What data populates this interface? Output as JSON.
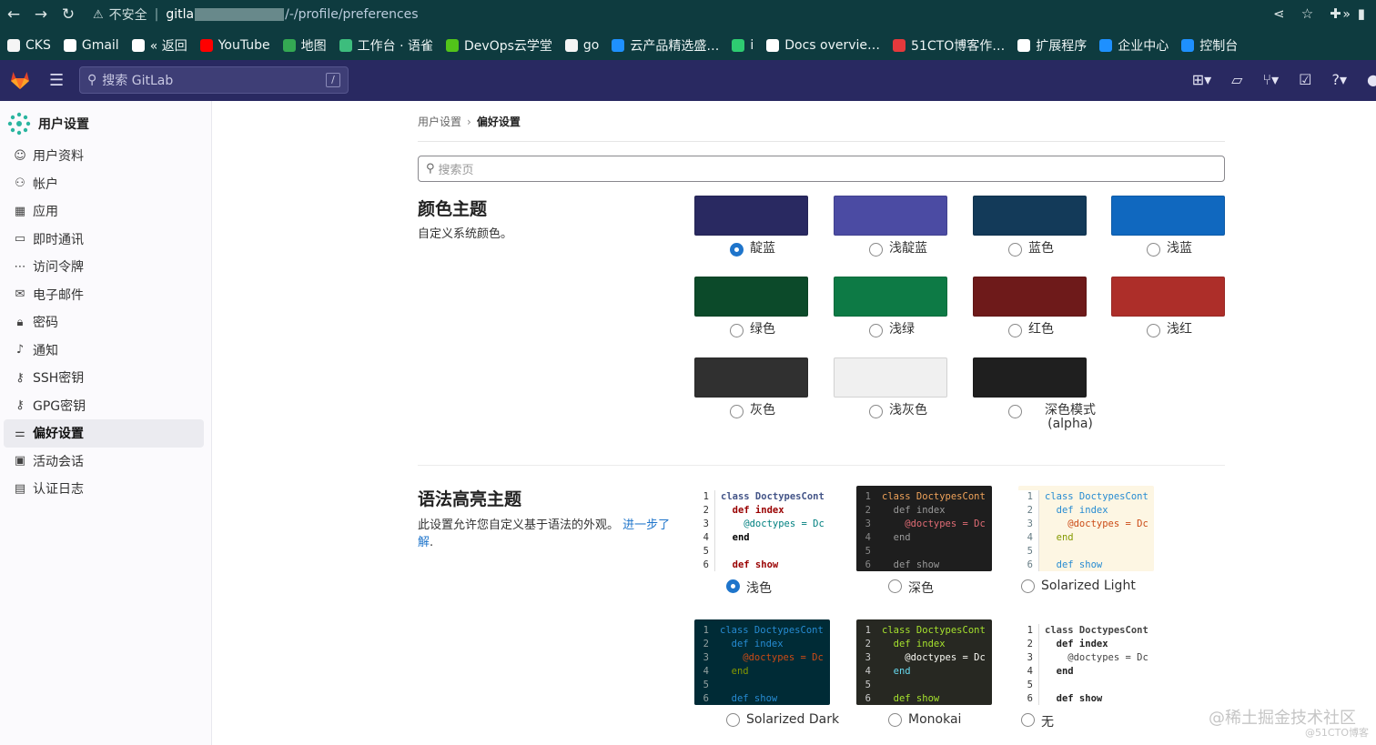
{
  "browser": {
    "security_label": "不安全",
    "host": "gitla",
    "path": "/-/profile/preferences",
    "bookmarks": [
      {
        "label": "CKS",
        "icon": "folder-icon",
        "color": "#f5f5f5"
      },
      {
        "label": "Gmail",
        "icon": "google-icon",
        "color": "#ffffff"
      },
      {
        "label": "« 返回",
        "icon": "globe-icon",
        "color": "#ffffff"
      },
      {
        "label": "YouTube",
        "icon": "youtube-icon",
        "color": "#ff0000"
      },
      {
        "label": "地图",
        "icon": "maps-icon",
        "color": "#34a853"
      },
      {
        "label": "工作台 · 语雀",
        "icon": "yuque-icon",
        "color": "#3dbd7d"
      },
      {
        "label": "DevOps云学堂",
        "icon": "devops-icon",
        "color": "#52c41a"
      },
      {
        "label": "go",
        "icon": "folder-icon",
        "color": "#f5f5f5"
      },
      {
        "label": "云产品精选盛…",
        "icon": "cloud-icon",
        "color": "#1e90ff"
      },
      {
        "label": "i",
        "icon": "green-s-icon",
        "color": "#2ecc71"
      },
      {
        "label": "Docs overvie…",
        "icon": "docs-icon",
        "color": "#ffffff"
      },
      {
        "label": "51CTO博客作…",
        "icon": "51cto-icon",
        "color": "#e4393c"
      },
      {
        "label": "扩展程序",
        "icon": "puzzle-icon",
        "color": "#ffffff"
      },
      {
        "label": "企业中心",
        "icon": "cloud-icon",
        "color": "#1e90ff"
      },
      {
        "label": "控制台",
        "icon": "cloud-icon",
        "color": "#1e90ff"
      }
    ],
    "more": "»"
  },
  "header": {
    "search_placeholder": "搜索 GitLab",
    "search_shortcut": "/"
  },
  "sidebar": {
    "title": "用户设置",
    "items": [
      {
        "label": "用户资料",
        "icon": "profile-icon",
        "glyph": "☺",
        "active": false
      },
      {
        "label": "帐户",
        "icon": "account-icon",
        "glyph": "⚇",
        "active": false
      },
      {
        "label": "应用",
        "icon": "applications-icon",
        "glyph": "▦",
        "active": false
      },
      {
        "label": "即时通讯",
        "icon": "chat-icon",
        "glyph": "▭",
        "active": false
      },
      {
        "label": "访问令牌",
        "icon": "token-icon",
        "glyph": "⋯",
        "active": false
      },
      {
        "label": "电子邮件",
        "icon": "mail-icon",
        "glyph": "✉",
        "active": false
      },
      {
        "label": "密码",
        "icon": "lock-icon",
        "glyph": "🔒︎",
        "active": false
      },
      {
        "label": "通知",
        "icon": "bell-icon",
        "glyph": "♪",
        "active": false
      },
      {
        "label": "SSH密钥",
        "icon": "key-icon",
        "glyph": "⚷",
        "active": false
      },
      {
        "label": "GPG密钥",
        "icon": "key-icon",
        "glyph": "⚷",
        "active": false
      },
      {
        "label": "偏好设置",
        "icon": "preferences-icon",
        "glyph": "⚌",
        "active": true
      },
      {
        "label": "活动会话",
        "icon": "monitor-icon",
        "glyph": "▣",
        "active": false
      },
      {
        "label": "认证日志",
        "icon": "log-icon",
        "glyph": "▤",
        "active": false
      }
    ]
  },
  "breadcrumb": {
    "parent": "用户设置",
    "current": "偏好设置"
  },
  "page_search_placeholder": "搜索页",
  "color_theme": {
    "title": "颜色主题",
    "description": "自定义系统颜色。",
    "options": [
      {
        "label": "靛蓝",
        "color": "#292961",
        "selected": true
      },
      {
        "label": "浅靛蓝",
        "color": "#4b4ba3",
        "selected": false
      },
      {
        "label": "蓝色",
        "color": "#133a59",
        "selected": false
      },
      {
        "label": "浅蓝",
        "color": "#1068bf",
        "selected": false
      },
      {
        "label": "绿色",
        "color": "#0c4a2a",
        "selected": false
      },
      {
        "label": "浅绿",
        "color": "#0d7a45",
        "selected": false
      },
      {
        "label": "红色",
        "color": "#6e1a1a",
        "selected": false
      },
      {
        "label": "浅红",
        "color": "#ad2e29",
        "selected": false
      },
      {
        "label": "灰色",
        "color": "#303030",
        "selected": false
      },
      {
        "label": "浅灰色",
        "color": "#f0f0f0",
        "selected": false
      },
      {
        "label": "深色模式",
        "sublabel": "(alpha)",
        "color": "#1f1f1f",
        "selected": false
      }
    ]
  },
  "syntax_theme": {
    "title": "语法高亮主题",
    "description": "此设置允许您自定义基于语法的外观。",
    "link_text": "进一步了解",
    "link_tail": ".",
    "code_lines": [
      "class DoctypesCont",
      "  def index",
      "    @doctypes = Dc",
      "  end",
      "",
      "  def show"
    ],
    "line_numbers": [
      "1",
      "2",
      "3",
      "4",
      "5",
      "6"
    ],
    "options": [
      {
        "label": "浅色",
        "selected": true,
        "bg": "#ffffff",
        "gutter_bg": "#ffffff",
        "gutter_fg": "#333333",
        "fg": "#333333",
        "kw": "#000000",
        "name": "#445588",
        "var": "#008080",
        "fn": "#990000"
      },
      {
        "label": "深色",
        "selected": false,
        "bg": "#1e1e1e",
        "gutter_bg": "#1e1e1e",
        "gutter_fg": "#888888",
        "fg": "#999999",
        "kw": "#999999",
        "name": "#f0a35a",
        "var": "#e06c75",
        "fn": "#999999"
      },
      {
        "label": "Solarized Light",
        "selected": false,
        "bg": "#fdf6e3",
        "gutter_bg": "#ffffff",
        "gutter_fg": "#657b83",
        "fg": "#93a1a1",
        "kw": "#859900",
        "name": "#268bd2",
        "var": "#cb4b16",
        "fn": "#268bd2"
      },
      {
        "label": "Solarized Dark",
        "selected": false,
        "bg": "#002b36",
        "gutter_bg": "#002b36",
        "gutter_fg": "#93a1a1",
        "fg": "#839496",
        "kw": "#859900",
        "name": "#268bd2",
        "var": "#cb4b16",
        "fn": "#268bd2"
      },
      {
        "label": "Monokai",
        "selected": false,
        "bg": "#272822",
        "gutter_bg": "#272822",
        "gutter_fg": "#cccccc",
        "fg": "#f8f8f2",
        "kw": "#66d9ef",
        "name": "#a6e22e",
        "var": "#f8f8f2",
        "fn": "#a6e22e"
      },
      {
        "label": "无",
        "selected": false,
        "bg": "#ffffff",
        "gutter_bg": "#ffffff",
        "gutter_fg": "#333333",
        "fg": "#333333",
        "kw": "#222222",
        "name": "#444444",
        "var": "#444444",
        "fn": "#222222"
      }
    ]
  },
  "watermark": {
    "main": "@稀土掘金技术社区",
    "sub": "@51CTO博客"
  }
}
